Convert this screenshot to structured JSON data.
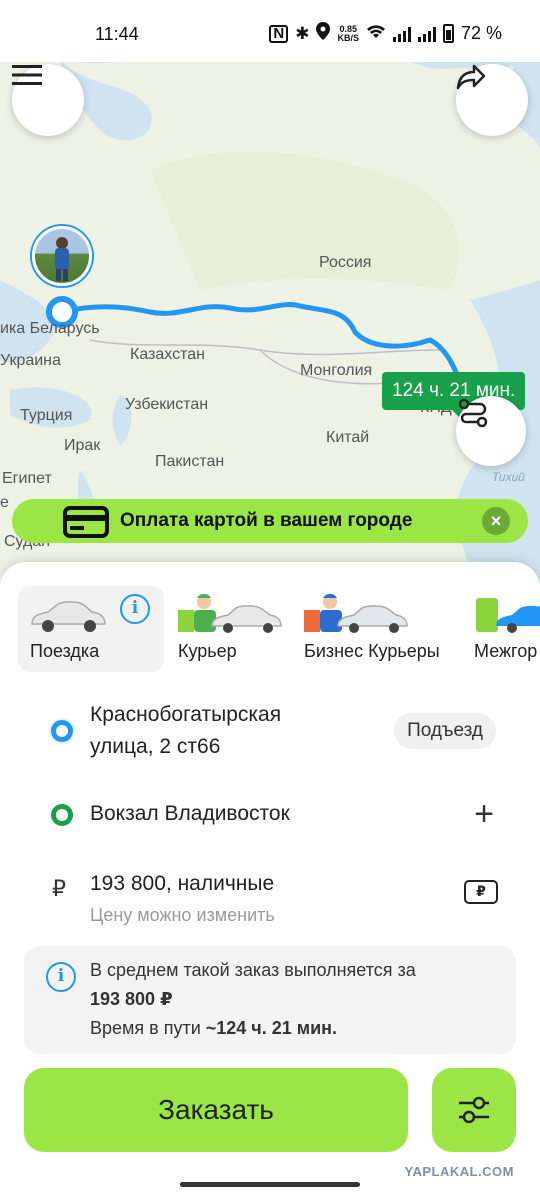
{
  "status_bar": {
    "time": "11:44",
    "net_speed_value": "0.85",
    "net_speed_unit": "KB/S",
    "battery": "72 %"
  },
  "map": {
    "labels": {
      "russia": "Россия",
      "belarus": "ика Беларусь",
      "ukraine": "Украина",
      "kazakhstan": "Казахстан",
      "mongolia": "Монголия",
      "uzbekistan": "Узбекистан",
      "turkey": "Турция",
      "iraq": "Ирак",
      "pakistan": "Пакистан",
      "china": "Китай",
      "egypt": "Египет",
      "sudan": "Судан",
      "kndr": "КНД",
      "pacific": "Тихий",
      "egypt_cut": "е"
    },
    "eta": "124 ч. 21 мин."
  },
  "promo": {
    "text": "Оплата картой в вашем городе",
    "close_icon": "×"
  },
  "tariffs": [
    {
      "label": "Поездка"
    },
    {
      "label": "Курьер"
    },
    {
      "label": "Бизнес Курьеры"
    },
    {
      "label": "Межгор"
    }
  ],
  "route": {
    "from_line1": "Краснобогатырская",
    "from_line2": "улица, 2 ст66",
    "entrance_label": "Подъезд",
    "to": "Вокзал Владивосток",
    "add_stop": "+"
  },
  "payment": {
    "currency_symbol": "₽",
    "price_line": "193 800, наличные",
    "hint": "Цену можно изменить"
  },
  "notice": {
    "line1": "В среднем такой заказ выполняется за",
    "line2": "193 800 ₽",
    "line3_prefix": "Время в пути ",
    "line3_value": "~124 ч. 21 мин."
  },
  "order_button": "Заказать",
  "watermark": "YAPLAKAL.COM",
  "colors": {
    "accent_green": "#9be545",
    "route_blue": "#2196f3",
    "destination_green": "#18a04a"
  }
}
